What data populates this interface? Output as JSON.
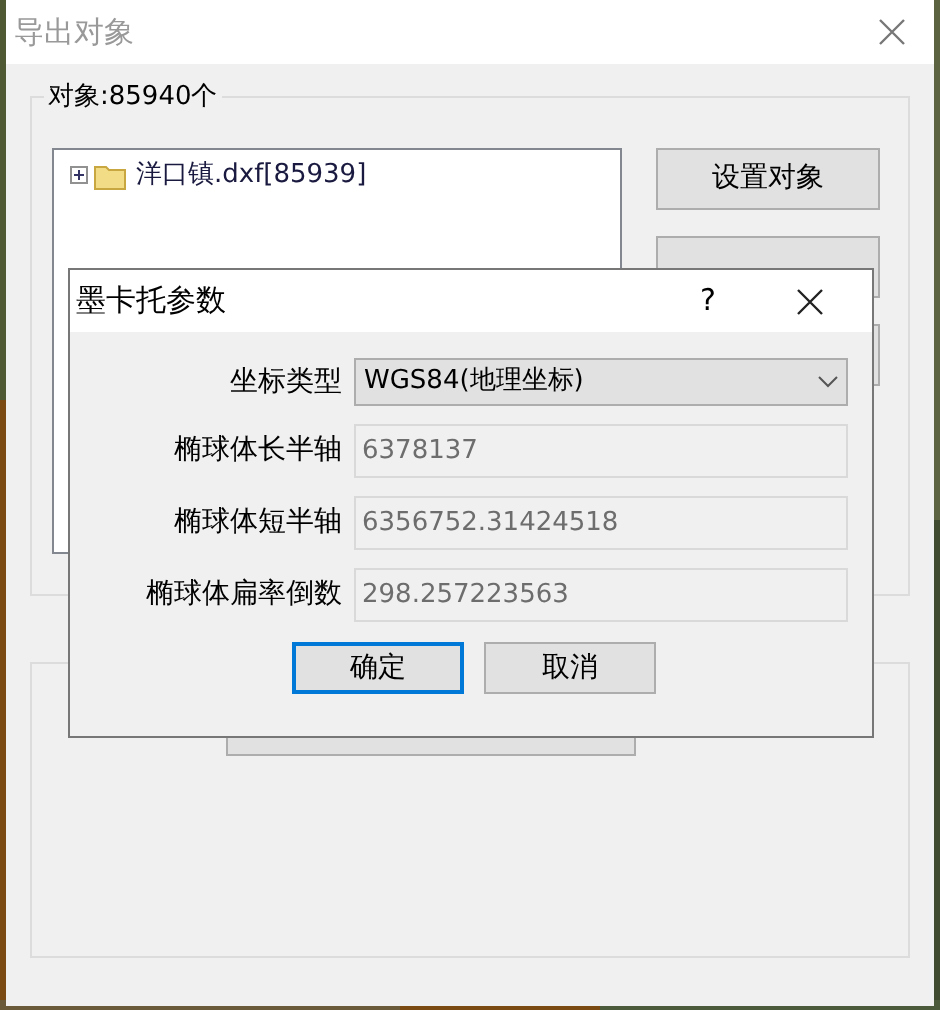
{
  "window": {
    "title": "导出对象",
    "active": false
  },
  "object_group": {
    "label": "对象:85940个",
    "tree": [
      {
        "label": "洋口镇.dxf[85939]",
        "expanded": false
      }
    ],
    "buttons": [
      "设置对象"
    ]
  },
  "dialog": {
    "title": "墨卡托参数",
    "help": "?",
    "fields": [
      {
        "kind": "combo",
        "label": "坐标类型",
        "value": "WGS84(地理坐标)",
        "disabled": false
      },
      {
        "kind": "text",
        "label": "椭球体长半轴",
        "value": "6378137",
        "disabled": true
      },
      {
        "kind": "text",
        "label": "椭球体短半轴",
        "value": "6356752.31424518",
        "disabled": true
      },
      {
        "kind": "text",
        "label": "椭球体扁率倒数",
        "value": "298.257223563",
        "disabled": true
      }
    ],
    "buttons": [
      {
        "label": "确定",
        "default": true
      },
      {
        "label": "取消",
        "default": false
      }
    ]
  }
}
